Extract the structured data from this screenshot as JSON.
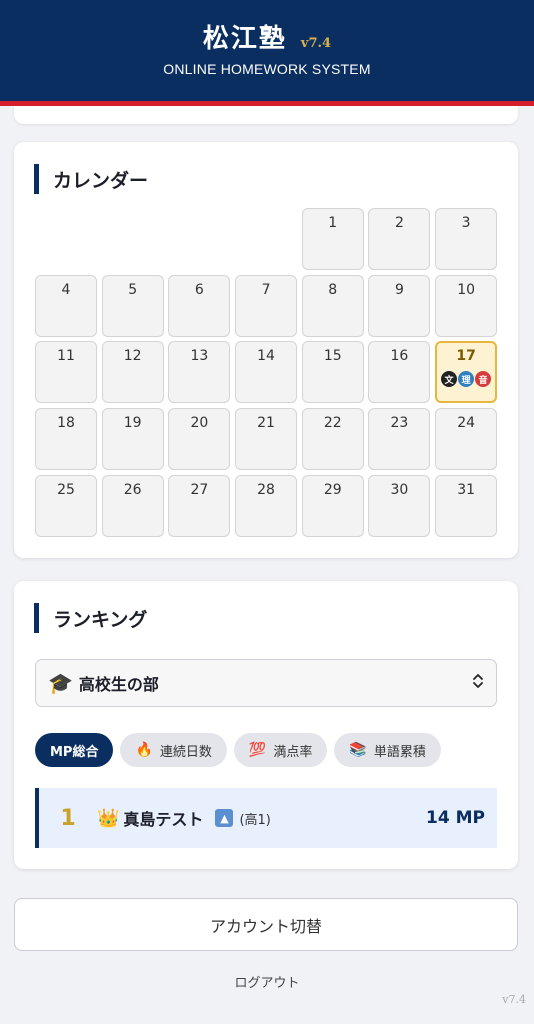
{
  "header": {
    "brand": "松江塾",
    "version": "v7.4",
    "subtitle": "ONLINE HOMEWORK SYSTEM"
  },
  "calendar": {
    "title": "カレンダー",
    "leading_blanks": 4,
    "days": [
      "1",
      "2",
      "3",
      "4",
      "5",
      "6",
      "7",
      "8",
      "9",
      "10",
      "11",
      "12",
      "13",
      "14",
      "15",
      "16",
      "17",
      "18",
      "19",
      "20",
      "21",
      "22",
      "23",
      "24",
      "25",
      "26",
      "27",
      "28",
      "29",
      "30",
      "31"
    ],
    "today": "17",
    "today_badges": [
      {
        "label": "文",
        "color": "#222222"
      },
      {
        "label": "理",
        "color": "#2f7fc1"
      },
      {
        "label": "音",
        "color": "#d63a3a"
      }
    ]
  },
  "ranking": {
    "title": "ランキング",
    "category": {
      "icon": "🎓",
      "label": "高校生の部"
    },
    "tabs": [
      {
        "label": "MP総合",
        "icon": "",
        "active": true
      },
      {
        "label": "連続日数",
        "icon": "🔥",
        "active": false
      },
      {
        "label": "満点率",
        "icon": "💯",
        "active": false
      },
      {
        "label": "単語累積",
        "icon": "📚",
        "active": false
      }
    ],
    "rows": [
      {
        "rank": "1",
        "icon": "👑",
        "name": "真島テスト",
        "grade": "(高1)",
        "score": "14 MP"
      }
    ]
  },
  "account_switch_label": "アカウント切替",
  "logout_label": "ログアウト",
  "footer_version": "v7.4",
  "colors": {
    "navy": "#0b2e61",
    "accent_red": "#d61f2c",
    "gold": "#e8b63c"
  }
}
